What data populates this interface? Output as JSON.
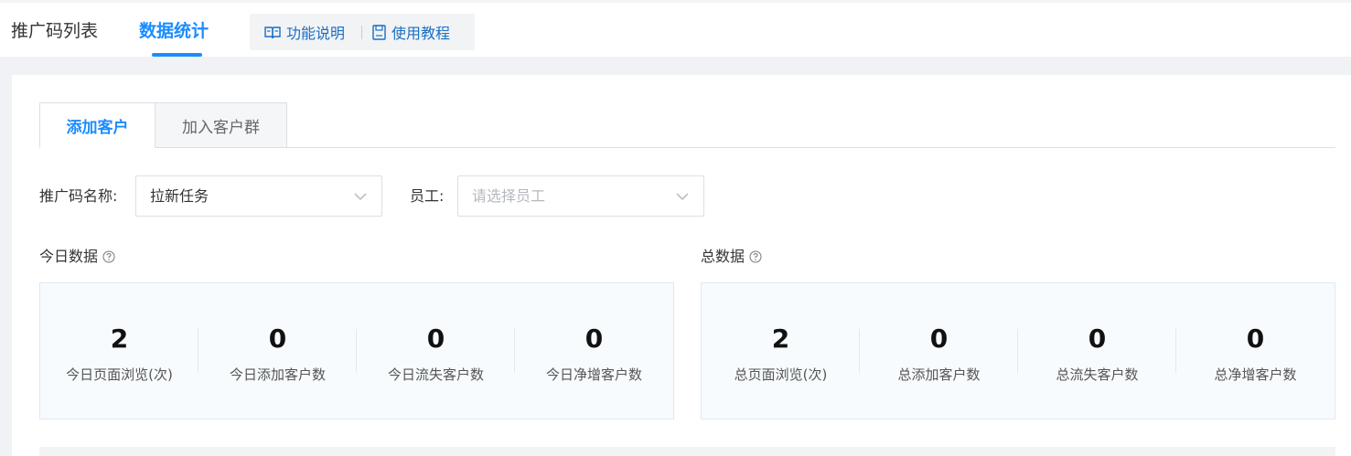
{
  "header": {
    "tabs": [
      {
        "label": "推广码列表"
      },
      {
        "label": "数据统计"
      }
    ],
    "help_links": [
      {
        "label": "功能说明",
        "icon": "book-icon"
      },
      {
        "label": "使用教程",
        "icon": "document-icon"
      }
    ]
  },
  "sub_tabs": [
    {
      "label": "添加客户"
    },
    {
      "label": "加入客户群"
    }
  ],
  "filters": {
    "code_name_label": "推广码名称:",
    "code_name_value": "拉新任务",
    "employee_label": "员工:",
    "employee_placeholder": "请选择员工"
  },
  "today": {
    "title": "今日数据",
    "stats": [
      {
        "value": "2",
        "label": "今日页面浏览(次)"
      },
      {
        "value": "0",
        "label": "今日添加客户数"
      },
      {
        "value": "0",
        "label": "今日流失客户数"
      },
      {
        "value": "0",
        "label": "今日净增客户数"
      }
    ]
  },
  "total": {
    "title": "总数据",
    "stats": [
      {
        "value": "2",
        "label": "总页面浏览(次)"
      },
      {
        "value": "0",
        "label": "总添加客户数"
      },
      {
        "value": "0",
        "label": "总流失客户数"
      },
      {
        "value": "0",
        "label": "总净增客户数"
      }
    ]
  },
  "colors": {
    "accent": "#1a8cff",
    "link": "#1a6fc4"
  }
}
